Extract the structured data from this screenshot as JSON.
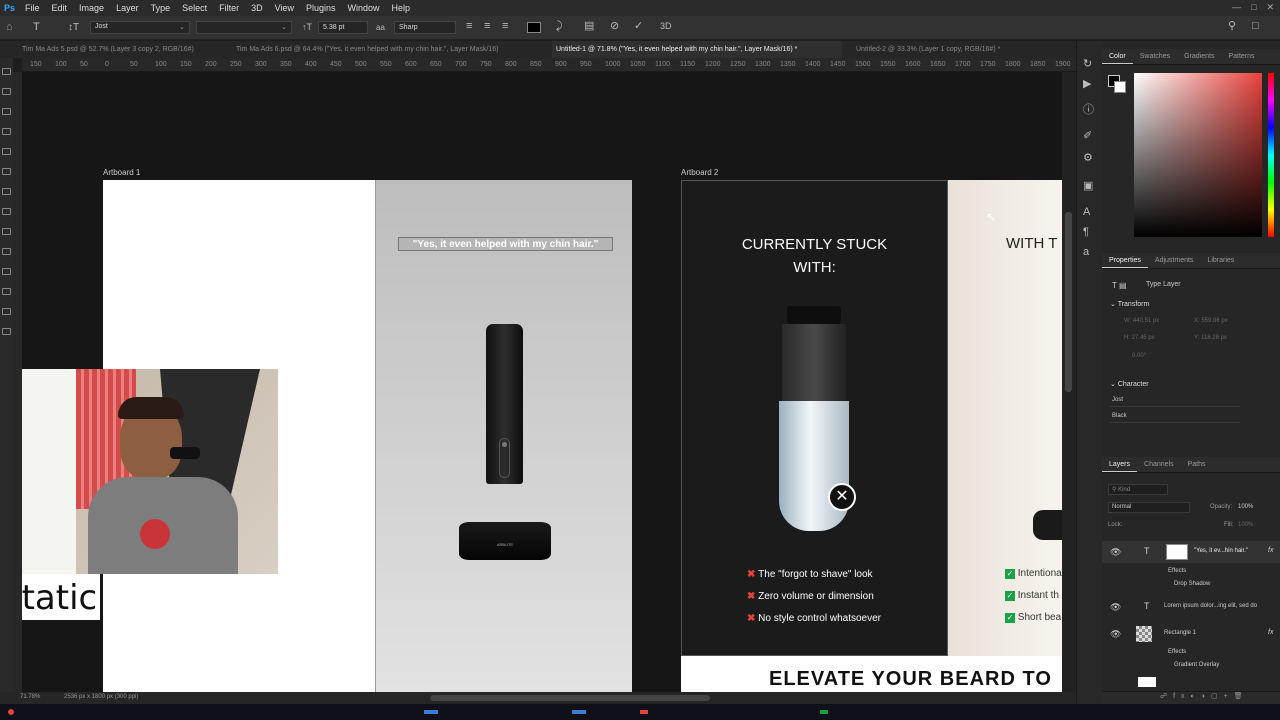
{
  "menu": [
    "File",
    "Edit",
    "Image",
    "Layer",
    "Type",
    "Select",
    "Filter",
    "3D",
    "View",
    "Plugins",
    "Window",
    "Help"
  ],
  "options": {
    "font_family": "Jost",
    "font_size": "5.38 pt",
    "antialias": "Sharp"
  },
  "tabs": [
    "Tim Ma Ads 5.psd @ 52.7% (Layer 3 copy 2, RGB/16#)",
    "Tim Ma Ads 6.psd @ 64.4% (\"Yes, it even helped with my chin hair.\", Layer Mask/16)",
    "Untitled-1 @ 71.8% (\"Yes, it even helped with my chin hair.\", Layer Mask/16) *",
    "Untitled-2 @ 33.3% (Layer 1 copy, RGB/16#) *"
  ],
  "ruler_ticks": [
    "150",
    "100",
    "50",
    "0",
    "50",
    "100",
    "150",
    "200",
    "250",
    "300",
    "350",
    "400",
    "450",
    "500",
    "550",
    "600",
    "650",
    "700",
    "750",
    "800",
    "850",
    "900",
    "950",
    "1000",
    "1050",
    "1100",
    "1150",
    "1200",
    "1250",
    "1300",
    "1350",
    "1400",
    "1450",
    "1500",
    "1550",
    "1600",
    "1650",
    "1700",
    "1750",
    "1800",
    "1850",
    "1900"
  ],
  "artboards": {
    "one": {
      "label": "Artboard 1",
      "quote": "\"Yes, it even helped with my chin hair.\"",
      "device_brand": "ARBUTE"
    },
    "two": {
      "label": "Artboard 2",
      "heading_line1": "CURRENTLY STUCK",
      "heading_line2": "WITH:",
      "bad_items": [
        "The \"forgot to shave\" look",
        "Zero volume or dimension",
        "No style control whatsoever"
      ],
      "right_heading": "WITH T",
      "good_items": [
        "Intentiona",
        "Instant th",
        "Short bea"
      ],
      "banner": "ELEVATE YOUR BEARD TO"
    }
  },
  "webcam_caption": "Static",
  "status": {
    "zoom": "71.78%",
    "doc": "2536 px x 1800 px (300 ppi)"
  },
  "panels": {
    "color_tabs": [
      "Color",
      "Swatches",
      "Gradients",
      "Patterns"
    ],
    "props_tabs": [
      "Properties",
      "Adjustments",
      "Libraries"
    ],
    "type_layer": "Type Layer",
    "transform": "Transform",
    "transform_vals": {
      "w": "W: 440.51 px",
      "x": "X: 559.86 px",
      "h": "H: 27.45 px",
      "y": "Y: 118.28 px",
      "angle": "0.00°"
    },
    "character": "Character",
    "char_font": "Jost",
    "char_style": "Black",
    "layers_tabs": [
      "Layers",
      "Channels",
      "Paths"
    ],
    "kind": "Kind",
    "blend": "Normal",
    "opacity_label": "Opacity:",
    "opacity": "100%",
    "lock_label": "Lock:",
    "fill_label": "Fill:",
    "fill": "100%",
    "layers": [
      {
        "name": "\"Yes, it ev...hin hair.\""
      },
      {
        "name": "Effects"
      },
      {
        "name": "Drop Shadow"
      },
      {
        "name": "Lorem ipsum dolor...ing elit, sed do"
      },
      {
        "name": "Rectangle 1"
      },
      {
        "name": "Effects"
      },
      {
        "name": "Gradient Overlay"
      }
    ]
  },
  "colors": {
    "accent": "#e8423c",
    "check": "#1aa046"
  }
}
